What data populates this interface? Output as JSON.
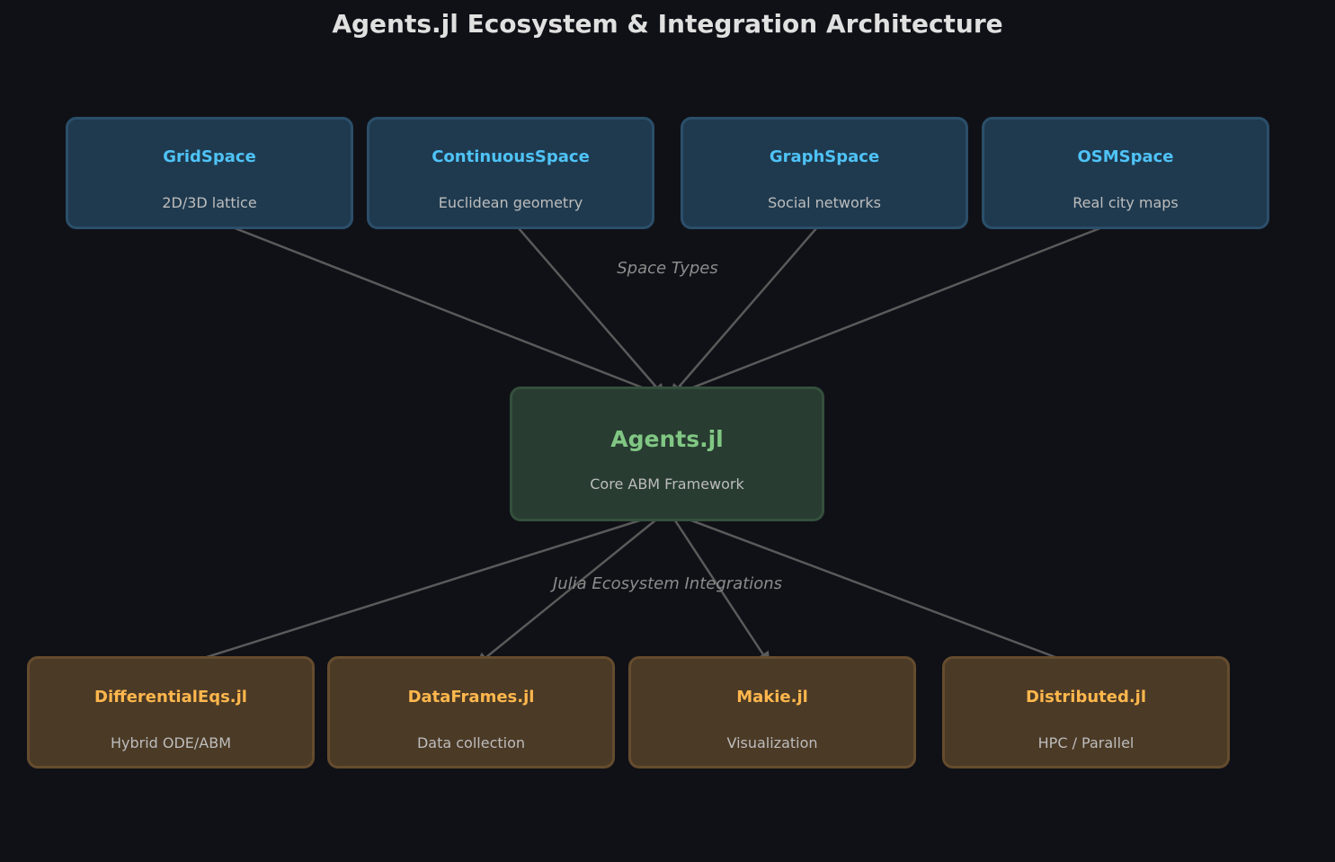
{
  "title": "Agents.jl Ecosystem & Integration Architecture",
  "space_types": {
    "label": "Space Types",
    "items": [
      {
        "name": "GridSpace",
        "desc": "2D/3D lattice"
      },
      {
        "name": "ContinuousSpace",
        "desc": "Euclidean geometry"
      },
      {
        "name": "GraphSpace",
        "desc": "Social networks"
      },
      {
        "name": "OSMSpace",
        "desc": "Real city maps"
      }
    ]
  },
  "core": {
    "name": "Agents.jl",
    "desc": "Core ABM Framework"
  },
  "integrations": {
    "label": "Julia Ecosystem Integrations",
    "items": [
      {
        "name": "DifferentialEqs.jl",
        "desc": "Hybrid ODE/ABM"
      },
      {
        "name": "DataFrames.jl",
        "desc": "Data collection"
      },
      {
        "name": "Makie.jl",
        "desc": "Visualization"
      },
      {
        "name": "Distributed.jl",
        "desc": "HPC / Parallel"
      }
    ]
  },
  "colors": {
    "background": "#101117",
    "space_accent": "#4fc3f7",
    "core_accent": "#81c784",
    "integration_accent": "#ffb74d",
    "edge": "#5a5a5a"
  }
}
